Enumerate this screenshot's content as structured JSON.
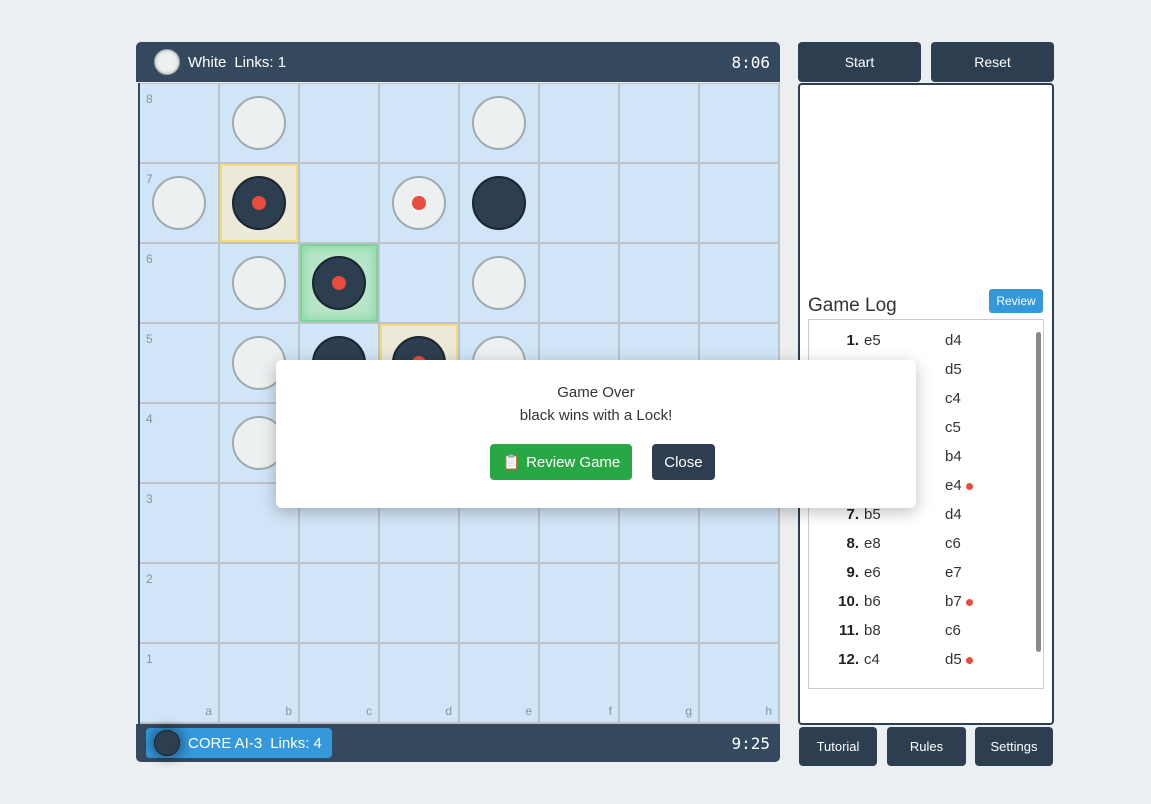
{
  "top_player": {
    "name": "White",
    "links": "Links: 1",
    "clock": "8:06",
    "color": "white"
  },
  "bottom_player": {
    "name": "CORE AI-3",
    "links": "Links: 4",
    "clock": "9:25",
    "color": "black",
    "active": true
  },
  "board": {
    "files": [
      "a",
      "b",
      "c",
      "d",
      "e",
      "f",
      "g",
      "h"
    ],
    "ranks": [
      "8",
      "7",
      "6",
      "5",
      "4",
      "3",
      "2",
      "1"
    ],
    "pieces": [
      {
        "sq": "b8",
        "c": "w"
      },
      {
        "sq": "e8",
        "c": "w"
      },
      {
        "sq": "a7",
        "c": "w"
      },
      {
        "sq": "b7",
        "c": "b",
        "dot": true
      },
      {
        "sq": "d7",
        "c": "w",
        "dot": true
      },
      {
        "sq": "e7",
        "c": "b"
      },
      {
        "sq": "b6",
        "c": "w"
      },
      {
        "sq": "c6",
        "c": "b",
        "dot": true
      },
      {
        "sq": "e6",
        "c": "w"
      },
      {
        "sq": "b5",
        "c": "w"
      },
      {
        "sq": "c5",
        "c": "b"
      },
      {
        "sq": "d5",
        "c": "b",
        "dot": true
      },
      {
        "sq": "e5",
        "c": "w"
      },
      {
        "sq": "b4",
        "c": "w"
      }
    ],
    "highlights": {
      "b7": "yellow",
      "d5": "yellow",
      "c6": "green"
    }
  },
  "controls": {
    "start": "Start",
    "reset": "Reset",
    "tutorial": "Tutorial",
    "rules": "Rules",
    "settings": "Settings"
  },
  "game_log": {
    "title": "Game Log",
    "review": "Review",
    "moves": [
      {
        "n": "1.",
        "w": "e5",
        "b": "d4"
      },
      {
        "n": "",
        "w": "",
        "b": "d5"
      },
      {
        "n": "",
        "w": "",
        "b": "c4"
      },
      {
        "n": "",
        "w": "",
        "b": "c5"
      },
      {
        "n": "",
        "w": "",
        "b": "b4"
      },
      {
        "n": "",
        "w": "",
        "b": "e4",
        "bdot": true
      },
      {
        "n": "7.",
        "w": "b5",
        "b": "d4"
      },
      {
        "n": "8.",
        "w": "e8",
        "b": "c6"
      },
      {
        "n": "9.",
        "w": "e6",
        "b": "e7"
      },
      {
        "n": "10.",
        "w": "b6",
        "b": "b7",
        "bdot": true
      },
      {
        "n": "11.",
        "w": "b8",
        "b": "c6"
      },
      {
        "n": "12.",
        "w": "c4",
        "b": "d5",
        "bdot": true
      }
    ]
  },
  "modal": {
    "title": "Game Over",
    "message": "black wins with a Lock!",
    "review_button": "Review Game",
    "review_icon": "clipboard-icon",
    "close_button": "Close"
  },
  "colors": {
    "accent": "#3498db",
    "dark": "#2c3e50",
    "success": "#28a745",
    "marker": "#e74c3c"
  }
}
